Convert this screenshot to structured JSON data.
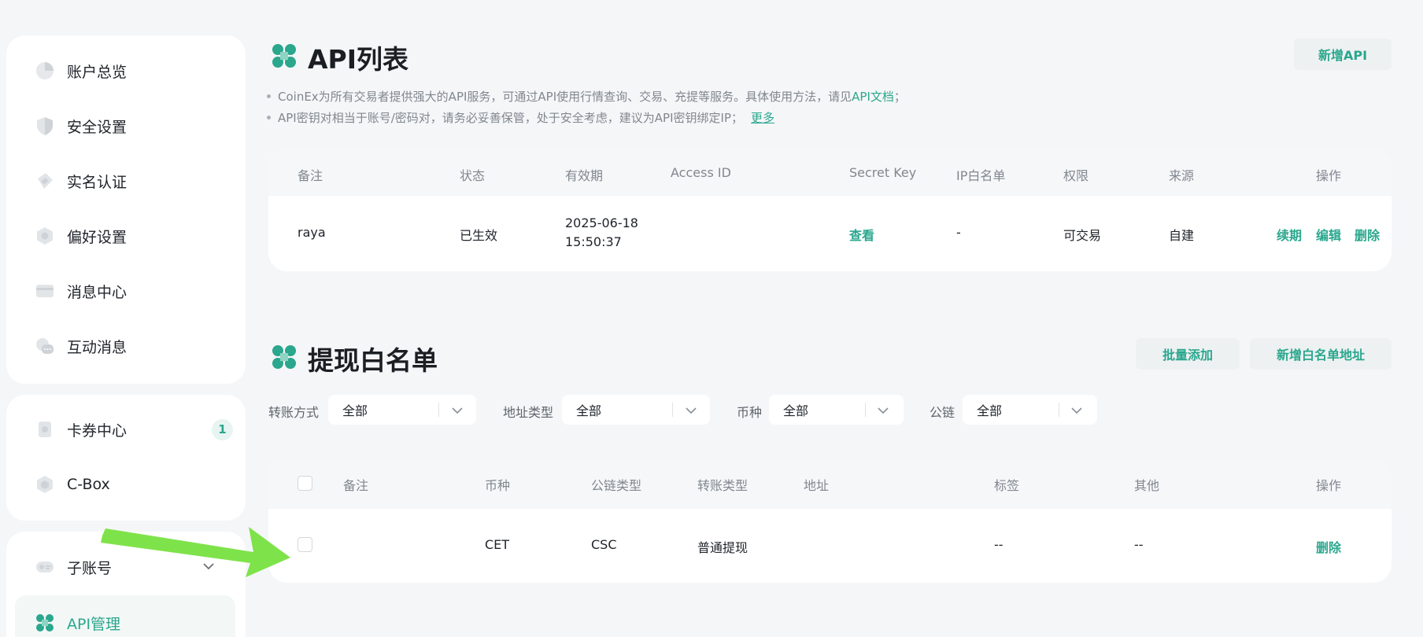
{
  "sidebar": {
    "group1": [
      {
        "label": "账户总览",
        "icon": "pie-chart-icon"
      },
      {
        "label": "安全设置",
        "icon": "shield-icon"
      },
      {
        "label": "实名认证",
        "icon": "id-card-icon"
      },
      {
        "label": "偏好设置",
        "icon": "settings-icon"
      },
      {
        "label": "消息中心",
        "icon": "message-icon"
      },
      {
        "label": "互动消息",
        "icon": "chat-icon"
      }
    ],
    "group2": [
      {
        "label": "卡券中心",
        "icon": "coupon-icon",
        "badge": "1"
      },
      {
        "label": "C-Box",
        "icon": "gift-box-icon"
      }
    ],
    "group3": [
      {
        "label": "子账号",
        "icon": "sub-account-icon"
      },
      {
        "label": "API管理",
        "icon": "api-icon"
      }
    ]
  },
  "api": {
    "title": "API列表",
    "add_button": "新增API",
    "notes": {
      "line1": "CoinEx为所有交易者提供强大的API服务，可通过API使用行情查询、交易、充提等服务。具体使用方法，请见",
      "line1_link": "API文档",
      "line1_end": "；",
      "line2": "API密钥对相当于账号/密码对，请务必妥善保管，处于安全考虑，建议为API密钥绑定IP；",
      "line2_link": "更多"
    },
    "headers": {
      "remark": "备注",
      "status": "状态",
      "validity": "有效期",
      "access_id": "Access ID",
      "secret_key": "Secret Key",
      "ip_whitelist": "IP白名单",
      "permission": "权限",
      "source": "来源",
      "actions": "操作"
    },
    "row": {
      "remark": "raya",
      "status": "已生效",
      "validity_date": "2025-06-18",
      "validity_time": "15:50:37",
      "access_id": "",
      "secret_key_link": "查看",
      "ip_whitelist": "-",
      "permission": "可交易",
      "source": "自建",
      "renew": "续期",
      "edit": "编辑",
      "delete": "删除"
    }
  },
  "whitelist": {
    "title": "提现白名单",
    "batch_add": "批量添加",
    "add_address": "新增白名单地址",
    "filters": {
      "transfer_label": "转账方式",
      "transfer_value": "全部",
      "addr_type_label": "地址类型",
      "addr_type_value": "全部",
      "coin_label": "币种",
      "coin_value": "全部",
      "chain_label": "公链",
      "chain_value": "全部"
    },
    "headers": {
      "remark": "备注",
      "coin": "币种",
      "chain_type": "公链类型",
      "transfer_type": "转账类型",
      "address": "地址",
      "tag": "标签",
      "other": "其他",
      "actions": "操作"
    },
    "row": {
      "remark": "",
      "coin": "CET",
      "chain_type": "CSC",
      "transfer_type": "普通提现",
      "address": "",
      "tag": "--",
      "other": "--",
      "delete": "删除"
    }
  },
  "colors": {
    "accent": "#2aa78d",
    "arrow": "#7ee34a"
  }
}
